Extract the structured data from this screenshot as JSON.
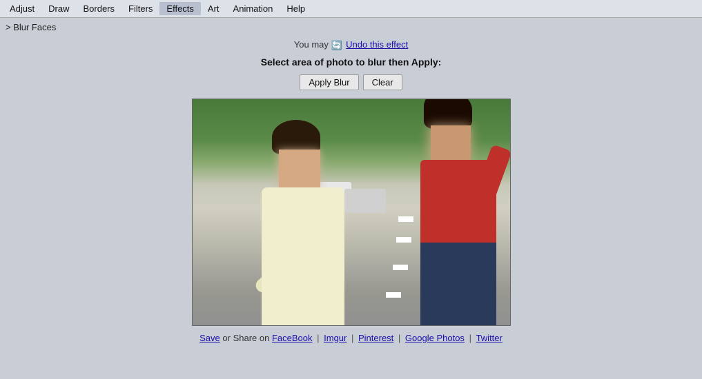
{
  "menubar": {
    "items": [
      {
        "label": "Adjust",
        "id": "adjust"
      },
      {
        "label": "Draw",
        "id": "draw"
      },
      {
        "label": "Borders",
        "id": "borders"
      },
      {
        "label": "Filters",
        "id": "filters"
      },
      {
        "label": "Effects",
        "id": "effects",
        "active": true
      },
      {
        "label": "Art",
        "id": "art"
      },
      {
        "label": "Animation",
        "id": "animation"
      },
      {
        "label": "Help",
        "id": "help"
      }
    ]
  },
  "breadcrumb": "> Blur Faces",
  "undo": {
    "prefix": "You may ",
    "link_text": "Undo this effect",
    "icon": "↩"
  },
  "instruction": "Select area of photo to blur then Apply:",
  "buttons": {
    "apply_blur": "Apply Blur",
    "clear": "Clear"
  },
  "footer": {
    "prefix": "Save",
    "separator1": " or Share on ",
    "links": [
      "FaceBook",
      "Imgur",
      "Pinterest",
      "Google Photos",
      "Twitter"
    ],
    "separators": [
      "|",
      "|",
      "|",
      "|"
    ]
  }
}
